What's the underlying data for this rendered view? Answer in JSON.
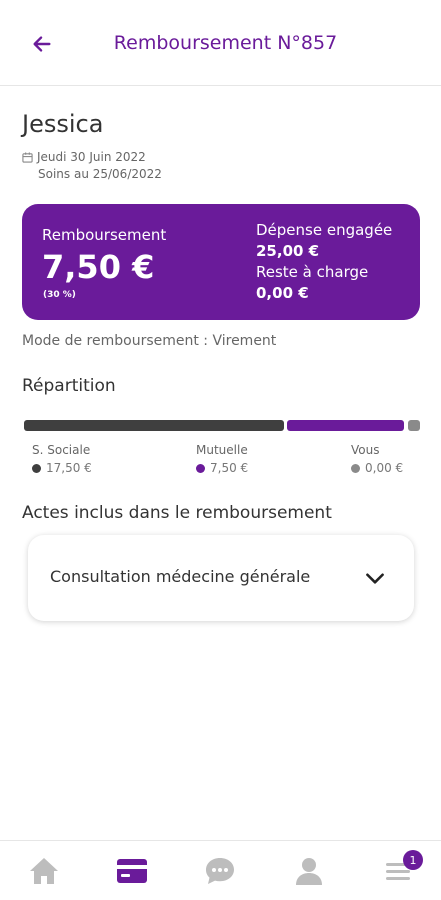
{
  "header": {
    "title": "Remboursement N°857",
    "back_icon": "arrow-left-icon"
  },
  "patient": {
    "name": "Jessica",
    "date": "Jeudi 30 Juin 2022",
    "care": "Soins au 25/06/2022"
  },
  "summary": {
    "reimbursement_label": "Remboursement",
    "reimbursement_amount": "7,50 €",
    "reimbursement_percent": "(30 %)",
    "expense_label": "Dépense engagée",
    "expense_amount": "25,00 €",
    "remaining_label": "Reste à charge",
    "remaining_amount": "0,00 €"
  },
  "mode": "Mode de remboursement : Virement",
  "repartition": {
    "title": "Répartition",
    "items": [
      {
        "name": "S. Sociale",
        "amount": "17,50 €",
        "color": "#3f3f3f"
      },
      {
        "name": "Mutuelle",
        "amount": "7,50 €",
        "color": "#6a1b9a"
      },
      {
        "name": "Vous",
        "amount": "0,00 €",
        "color": "#8a8a8a"
      }
    ]
  },
  "actes": {
    "title": "Actes inclus dans le remboursement",
    "items": [
      {
        "label": "Consultation médecine générale"
      }
    ]
  },
  "nav": {
    "items": [
      "home-icon",
      "card-icon",
      "chat-icon",
      "user-icon",
      "menu-icon"
    ],
    "active": "card-icon",
    "badge": "1"
  },
  "colors": {
    "primary": "#6a1b9a",
    "inactive": "#bdbdbd"
  }
}
